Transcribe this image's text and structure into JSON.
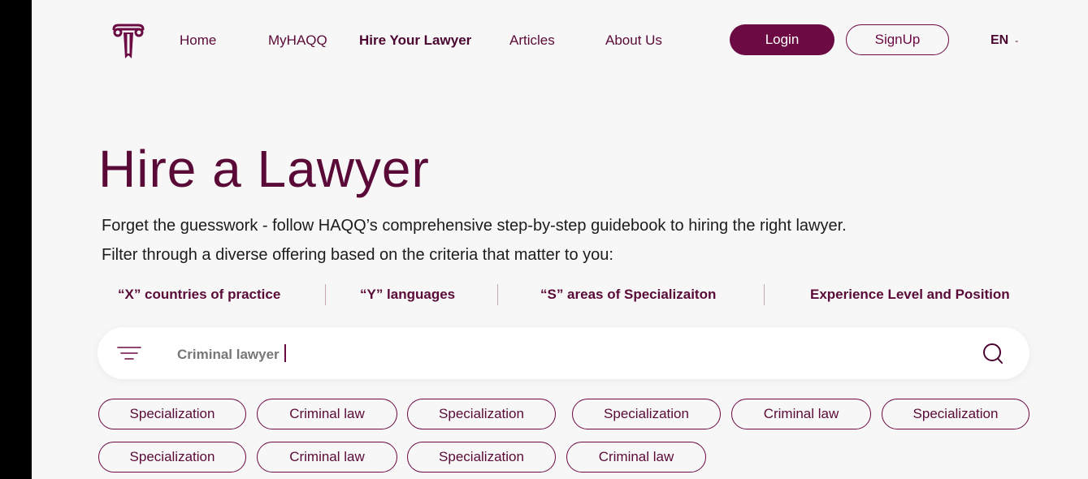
{
  "nav": {
    "items": [
      {
        "label": "Home",
        "active": false
      },
      {
        "label": "MyHAQQ",
        "active": false
      },
      {
        "label": "Hire Your Lawyer",
        "active": true
      },
      {
        "label": "Articles",
        "active": false
      },
      {
        "label": "About Us",
        "active": false
      }
    ],
    "login_label": "Login",
    "signup_label": "SignUp",
    "language": "EN",
    "language_caret": "-"
  },
  "hero": {
    "title": "Hire a Lawyer",
    "line1": "Forget the guesswork - follow HAQQ’s comprehensive step-by-step guidebook to hiring the right lawyer.",
    "line2": "Filter through a diverse offering based on the criteria that matter to you:"
  },
  "criteria": [
    "“X” countries of practice",
    "“Y”  languages",
    "“S” areas of Specializaiton",
    "Experience Level and Position"
  ],
  "search": {
    "value": "Criminal lawyer"
  },
  "chips": {
    "row1": [
      "Specialization",
      "Criminal law",
      "Specialization",
      "Specialization",
      "Criminal law",
      "Specialization"
    ],
    "row2": [
      "Specialization",
      "Criminal law",
      "Specialization",
      "Criminal law"
    ]
  },
  "colors": {
    "brand": "#6b0a43",
    "background": "#f7f7f7"
  }
}
